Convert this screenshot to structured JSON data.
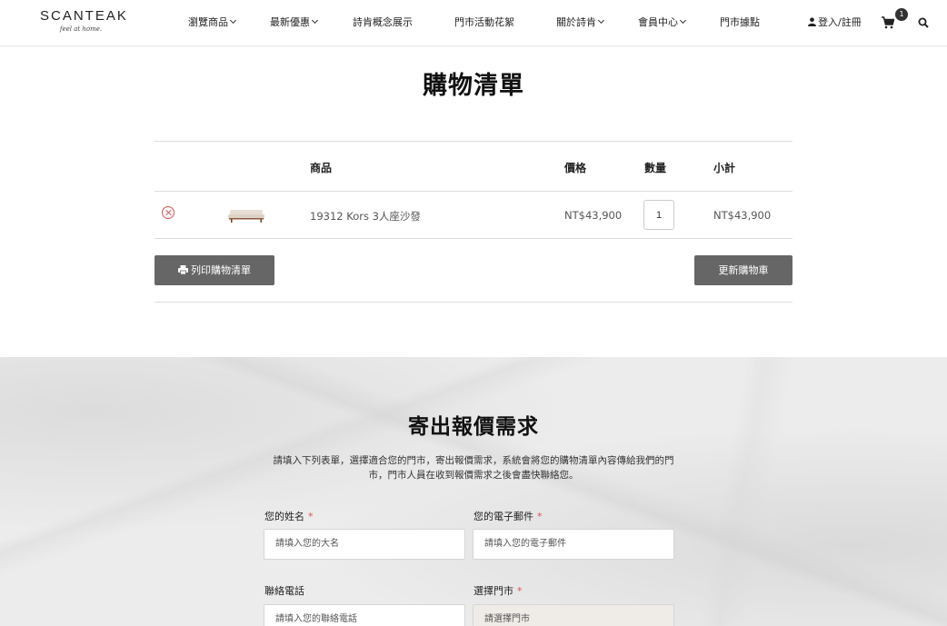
{
  "header": {
    "logo_brand": "SCANTEAK",
    "logo_tagline": "feel at home.",
    "nav": [
      {
        "label": "瀏覽商品",
        "dropdown": true
      },
      {
        "label": "最新優惠",
        "dropdown": true
      },
      {
        "label": "詩肯概念展示",
        "dropdown": false
      },
      {
        "label": "門市活動花絮",
        "dropdown": false
      },
      {
        "label": "關於詩肯",
        "dropdown": true
      },
      {
        "label": "會員中心",
        "dropdown": true
      },
      {
        "label": "門市據點",
        "dropdown": false
      }
    ],
    "login_label": "登入/註冊",
    "cart_count": "1"
  },
  "page_title": "購物清單",
  "cart": {
    "columns": {
      "product": "商品",
      "price": "價格",
      "quantity": "數量",
      "subtotal": "小計"
    },
    "items": [
      {
        "name": "19312 Kors 3人座沙發",
        "price": "NT$43,900",
        "quantity": "1",
        "subtotal": "NT$43,900"
      }
    ],
    "print_button": "列印購物清單",
    "update_button": "更新購物車"
  },
  "quote": {
    "title": "寄出報價需求",
    "description": "請填入下列表單，選擇適合您的門市，寄出報價需求，系統會將您的購物清單內容傳給我們的門市，門市人員在收到報價需求之後會盡快聯絡您。",
    "name_label": "您的姓名",
    "name_placeholder": "請填入您的大名",
    "email_label": "您的電子郵件",
    "email_placeholder": "請填入您的電子郵件",
    "phone_label": "聯絡電話",
    "phone_placeholder": "請填入您的聯絡電話",
    "store_label": "選擇門市",
    "store_placeholder": "請選擇門市",
    "required_mark": "*"
  }
}
